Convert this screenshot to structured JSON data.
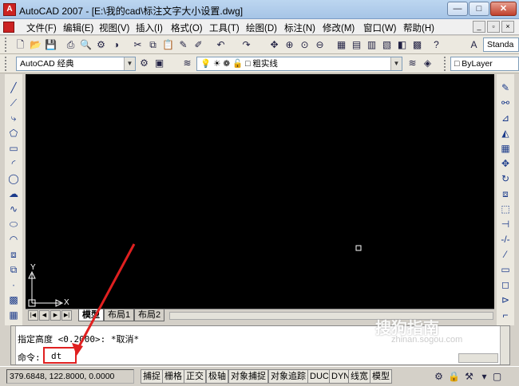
{
  "window": {
    "title": "AutoCAD 2007 - [E:\\我的cad\\标注文字大小设置.dwg]",
    "app_icon": "A",
    "controls": [
      "—",
      "□",
      "✕"
    ]
  },
  "menu": {
    "items": [
      "文件(F)",
      "编辑(E)",
      "视图(V)",
      "插入(I)",
      "格式(O)",
      "工具(T)",
      "绘图(D)",
      "标注(N)",
      "修改(M)",
      "窗口(W)",
      "帮助(H)"
    ],
    "mdi_controls": [
      "_",
      "▫",
      "×"
    ]
  },
  "toolbar1": {
    "text_style_combo": "Standa"
  },
  "toolbar2": {
    "workspace_combo": "AutoCAD 经典",
    "layer_combo": "粗实线",
    "linetype_combo": "ByLayer"
  },
  "ucs": {
    "y_label": "Y",
    "x_label": "X"
  },
  "tabs": {
    "nav": [
      "|◀",
      "◀",
      "▶",
      "▶|"
    ],
    "items": [
      "模型",
      "布局1",
      "布局2"
    ]
  },
  "command": {
    "line1": "指定高度 <0.2000>: *取消*",
    "prompt": "命令:",
    "input_value": "dt"
  },
  "status": {
    "coords": "379.6848, 122.8000, 0.0000",
    "toggles": [
      "捕捉",
      "栅格",
      "正交",
      "极轴",
      "对象捕捉",
      "对象追踪",
      "DUCS",
      "DYN",
      "线宽",
      "模型"
    ]
  },
  "watermark": {
    "logo_text": "搜狗指南",
    "url": "zhinan.sogou.com"
  },
  "colors": {
    "canvas": "#000000",
    "annotation_arrow": "#e02020"
  }
}
